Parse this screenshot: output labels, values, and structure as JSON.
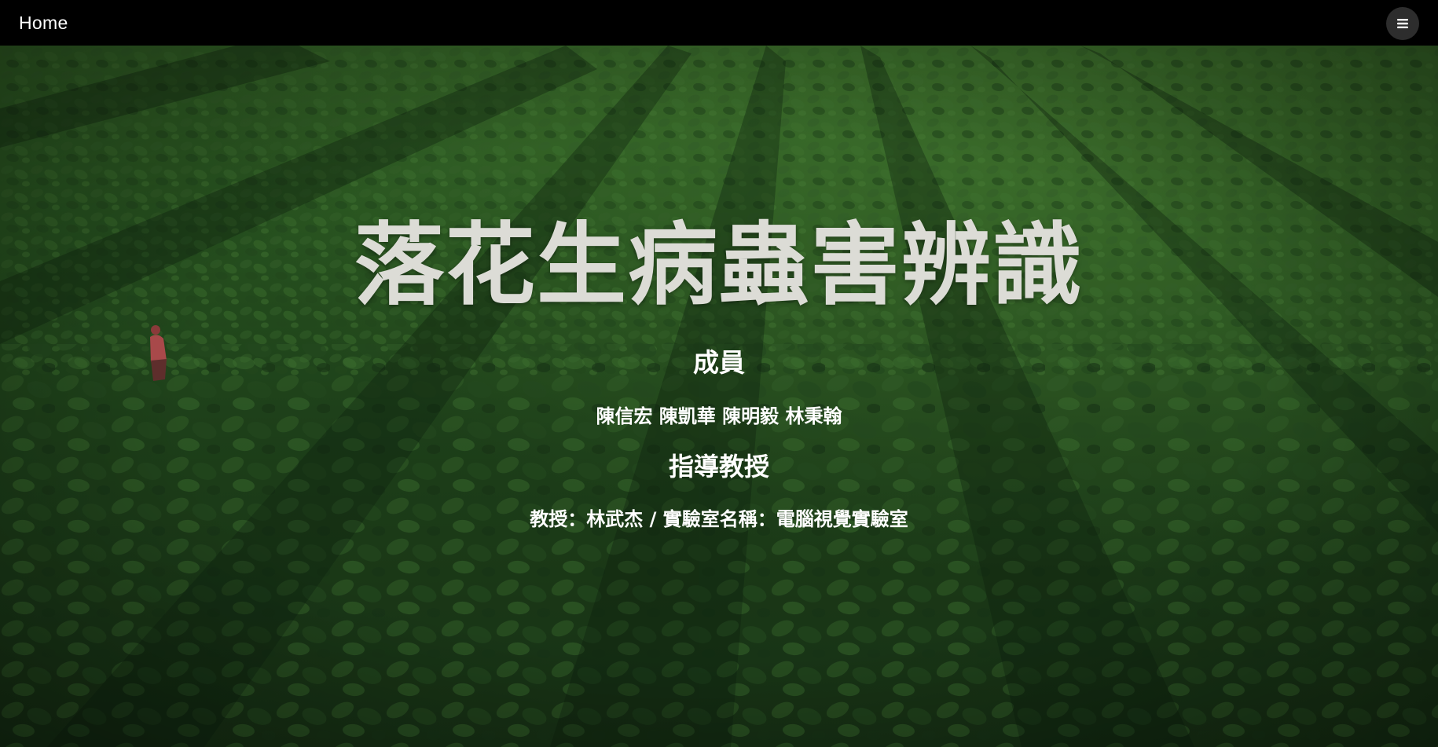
{
  "navbar": {
    "brand": "Home",
    "menu_icon": "hamburger-menu-icon"
  },
  "hero": {
    "title": "落花生病蟲害辨識",
    "members_heading": "成員",
    "members": "陳信宏 陳凱華 陳明毅 林秉翰",
    "advisor_heading": "指導教授",
    "advisor_info": "教授：林武杰 / 實驗室名稱：電腦視覺實驗室"
  },
  "colors": {
    "navbar_bg": "#000000",
    "menu_button_bg": "#2d2d2d",
    "title_color": "#dcdcd6",
    "text_color": "#ffffff",
    "field_green": "#2f5a26"
  }
}
